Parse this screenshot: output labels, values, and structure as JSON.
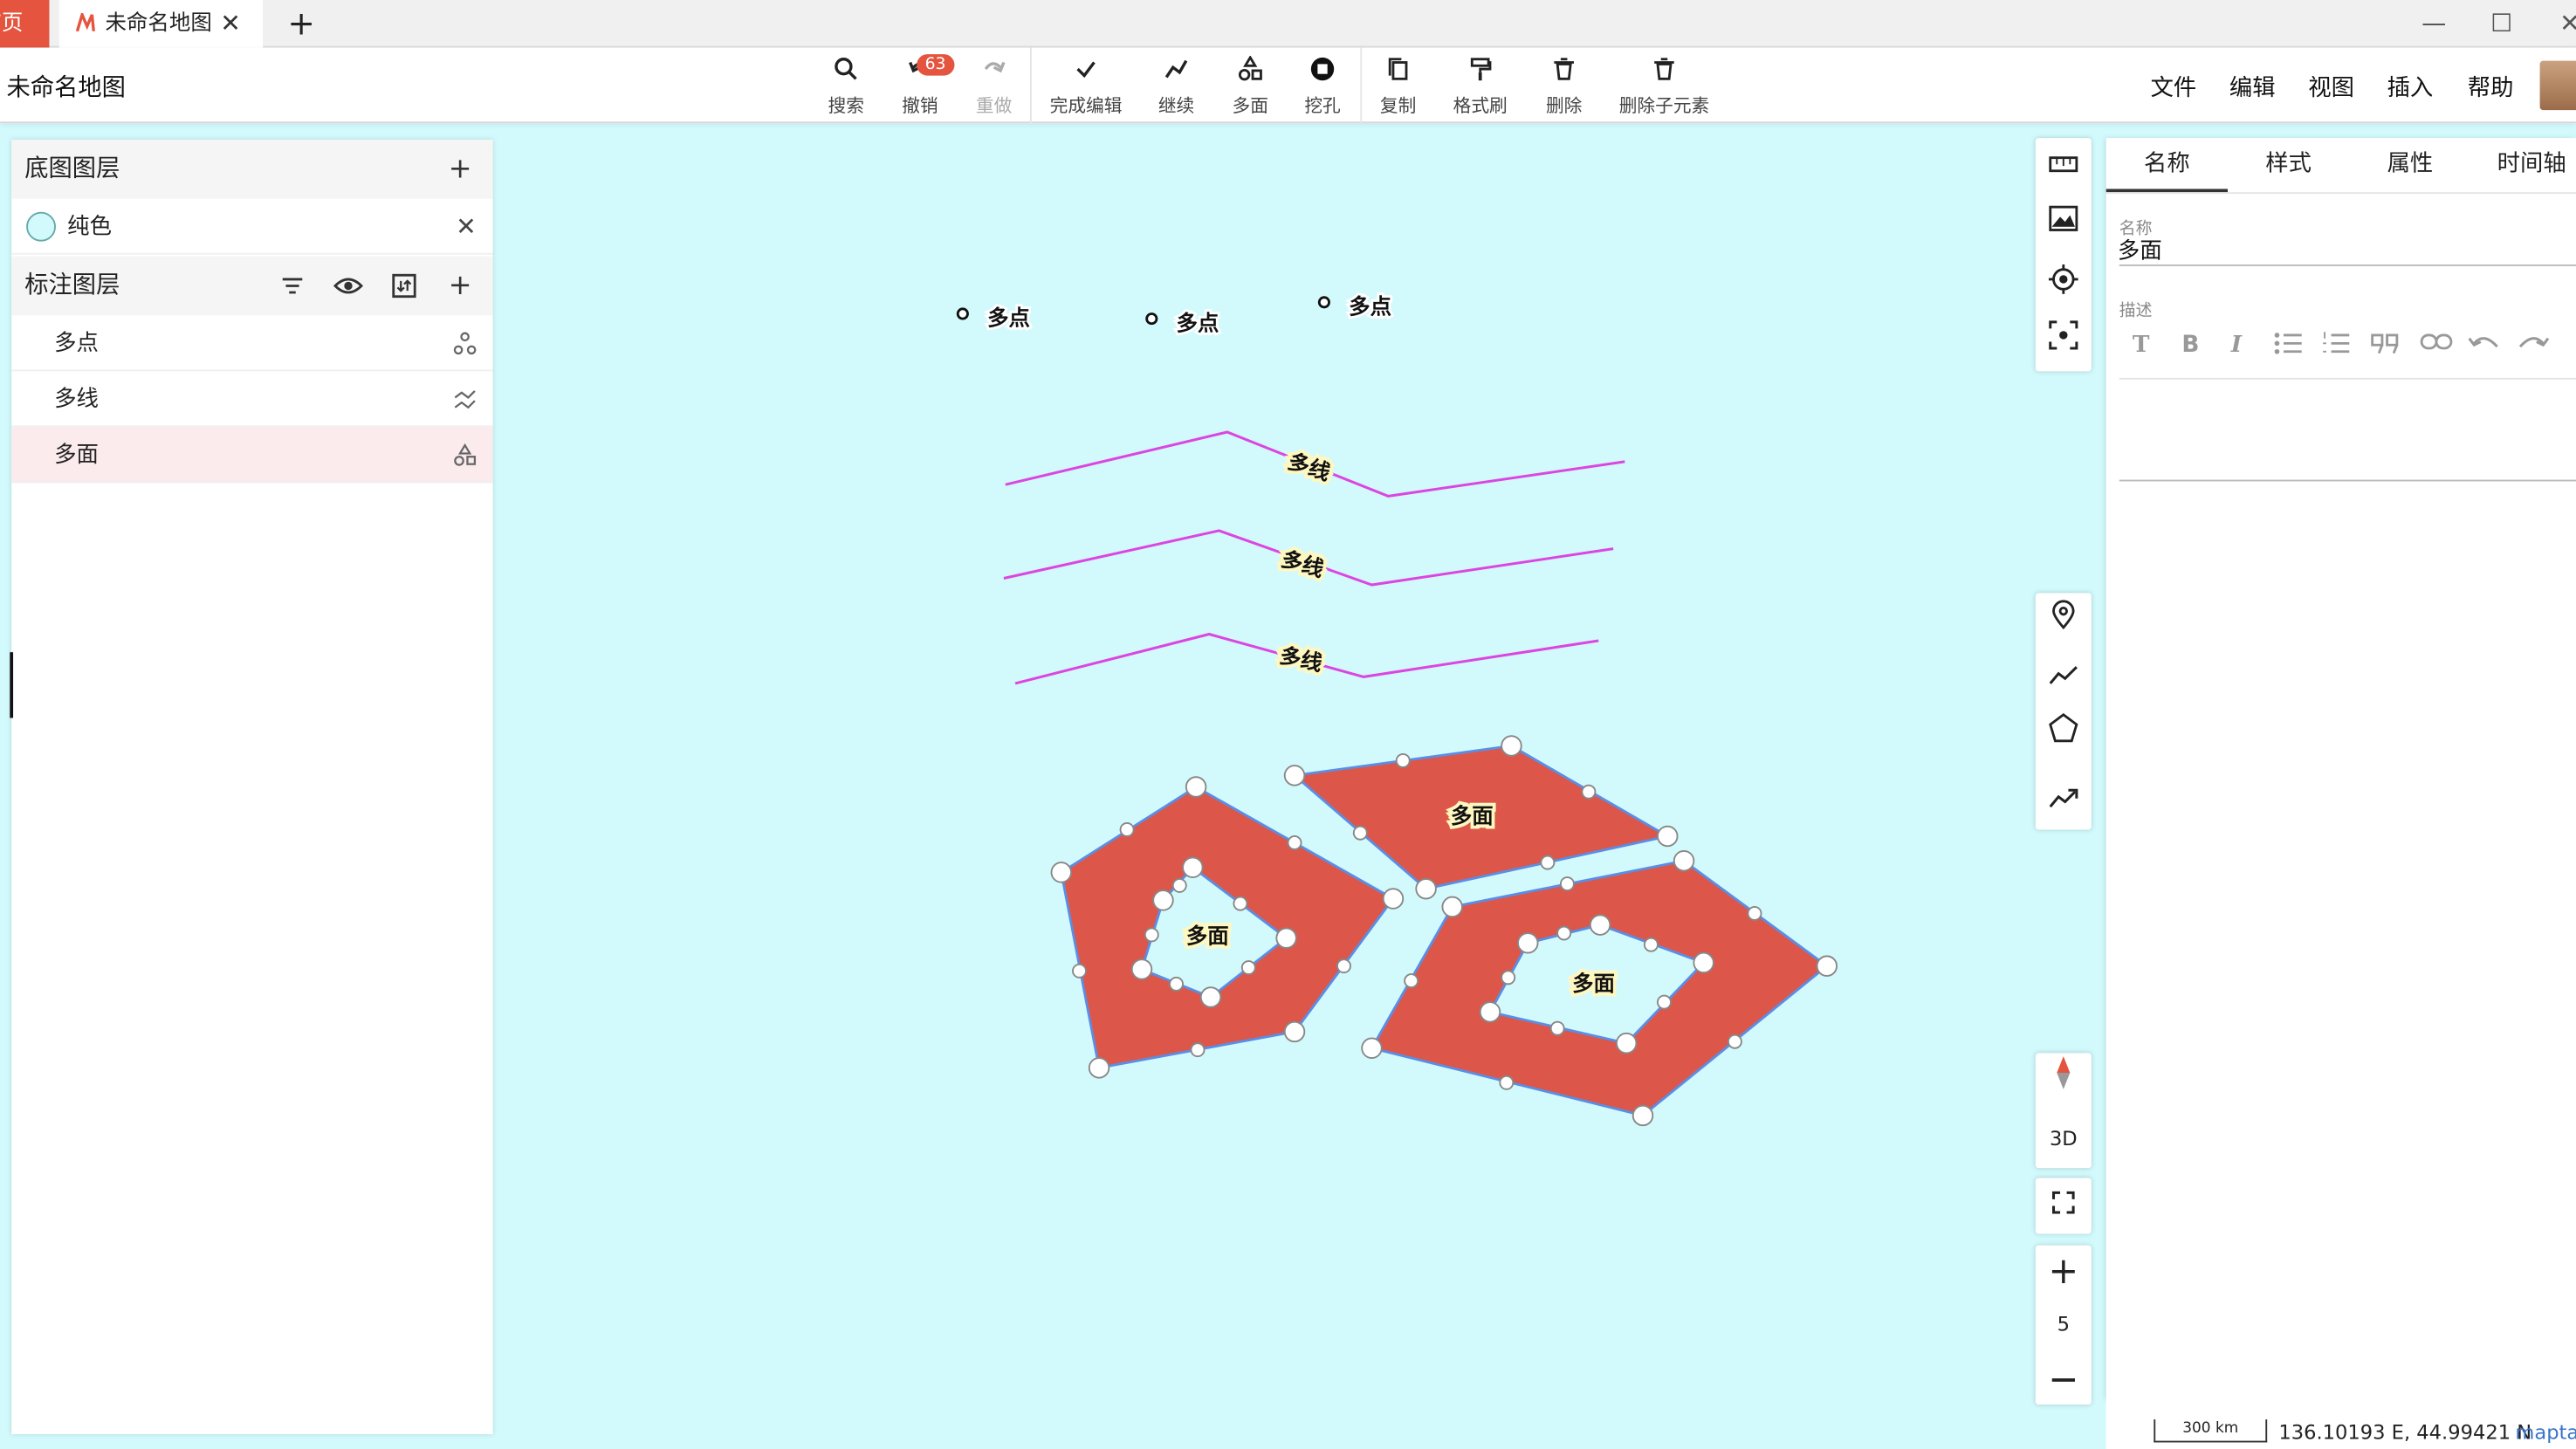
{
  "tabs": {
    "home_label": "首页",
    "active_label": "未命名地图",
    "close_glyph": "✕",
    "add_glyph": "+"
  },
  "window": {
    "minimize": "—",
    "maximize": "☐",
    "close": "✕"
  },
  "toolbar": {
    "doc_title": "未命名地图",
    "undo_badge": "63",
    "tools": [
      {
        "label": "搜索",
        "icon": "search-icon"
      },
      {
        "label": "撤销",
        "icon": "undo-icon"
      },
      {
        "label": "重做",
        "icon": "redo-icon"
      },
      {
        "label": "完成编辑",
        "icon": "check-icon"
      },
      {
        "label": "继续",
        "icon": "polyline-icon"
      },
      {
        "label": "多面",
        "icon": "shapes-icon"
      },
      {
        "label": "挖孔",
        "icon": "hole-icon"
      },
      {
        "label": "复制",
        "icon": "copy-icon"
      },
      {
        "label": "格式刷",
        "icon": "format-brush-icon"
      },
      {
        "label": "删除",
        "icon": "trash-icon"
      },
      {
        "label": "删除子元素",
        "icon": "trash-icon"
      }
    ],
    "menus": [
      "文件",
      "编辑",
      "视图",
      "插入",
      "帮助"
    ]
  },
  "left_panel": {
    "base_layers_title": "底图图层",
    "base_layer_name": "纯色",
    "annotation_layers_title": "标注图层",
    "layers": [
      {
        "name": "多点",
        "icon": "multipoint-icon"
      },
      {
        "name": "多线",
        "icon": "multiline-icon"
      },
      {
        "name": "多面",
        "icon": "multipolygon-icon"
      }
    ]
  },
  "right_panel": {
    "tabs": [
      "名称",
      "样式",
      "属性",
      "时间轴"
    ],
    "name_label": "名称",
    "name_value": "多面",
    "desc_label": "描述"
  },
  "map": {
    "point_labels": [
      "多点",
      "多点",
      "多点"
    ],
    "line_labels": [
      "多线",
      "多线",
      "多线"
    ],
    "polygon_labels": [
      "多面",
      "多面",
      "多面"
    ],
    "line_color": "#dc46e0",
    "polygon_fill": "#dc574a",
    "polygon_stroke": "#5a8ee6",
    "background": "#d2fafc"
  },
  "side_tools": {
    "mode_3d": "3D",
    "zoom_level": "5"
  },
  "status": {
    "scale_label": "300 km",
    "coordinates": "136.10193 E, 44.99421 N",
    "brand": "mapta"
  },
  "colors": {
    "accent": "#e4543f",
    "selected_row": "#fbebed"
  }
}
